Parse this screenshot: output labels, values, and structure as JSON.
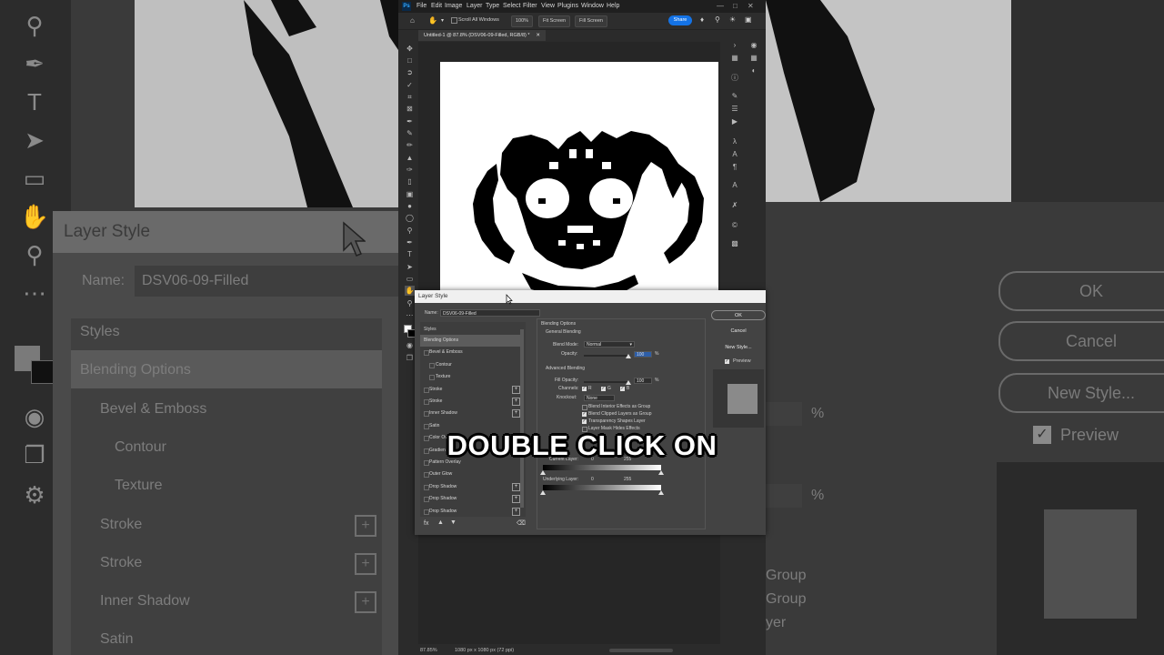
{
  "menu": {
    "app_badge": "Ps",
    "items": [
      "File",
      "Edit",
      "Image",
      "Layer",
      "Type",
      "Select",
      "Filter",
      "View",
      "Plugins",
      "Window",
      "Help"
    ]
  },
  "options_bar": {
    "scroll_all_windows": "Scroll All Windows",
    "zoom": "100%",
    "fit_screen": "Fit Screen",
    "fill_screen": "Fill Screen",
    "share": "Share"
  },
  "document_tab": "Untitled-1 @ 87.8% (DSV06-09-Filled, RGB/8) *",
  "status_bar": {
    "zoom": "87.85%",
    "size": "1080 px x 1080 px (72 ppi)"
  },
  "layer_style": {
    "title": "Layer Style",
    "name_label": "Name:",
    "name_value": "DSV06-09-Filled",
    "styles_header": "Styles",
    "items": [
      {
        "label": "Blending Options",
        "checkbox": false,
        "plus": false,
        "selected": true,
        "indent": false
      },
      {
        "label": "Bevel & Emboss",
        "checkbox": true,
        "plus": false,
        "selected": false,
        "indent": false
      },
      {
        "label": "Contour",
        "checkbox": true,
        "plus": false,
        "selected": false,
        "indent": true
      },
      {
        "label": "Texture",
        "checkbox": true,
        "plus": false,
        "selected": false,
        "indent": true
      },
      {
        "label": "Stroke",
        "checkbox": true,
        "plus": true,
        "selected": false,
        "indent": false
      },
      {
        "label": "Stroke",
        "checkbox": true,
        "plus": true,
        "selected": false,
        "indent": false
      },
      {
        "label": "Inner Shadow",
        "checkbox": true,
        "plus": true,
        "selected": false,
        "indent": false
      },
      {
        "label": "Satin",
        "checkbox": true,
        "plus": false,
        "selected": false,
        "indent": false
      },
      {
        "label": "Color Ov",
        "checkbox": true,
        "plus": false,
        "selected": false,
        "indent": false
      },
      {
        "label": "Gradien",
        "checkbox": true,
        "plus": false,
        "selected": false,
        "indent": false
      },
      {
        "label": "Pattern Overlay",
        "checkbox": true,
        "plus": false,
        "selected": false,
        "indent": false
      },
      {
        "label": "Outer Glow",
        "checkbox": true,
        "plus": false,
        "selected": false,
        "indent": false
      },
      {
        "label": "Drop Shadow",
        "checkbox": true,
        "plus": true,
        "selected": false,
        "indent": false
      },
      {
        "label": "Drop Shadow",
        "checkbox": true,
        "plus": true,
        "selected": false,
        "indent": false
      },
      {
        "label": "Drop Shadow",
        "checkbox": true,
        "plus": true,
        "selected": false,
        "indent": false
      }
    ],
    "blending": {
      "section_title": "Blending Options",
      "general_title": "General Blending",
      "blend_mode_label": "Blend Mode:",
      "blend_mode_value": "Normal",
      "opacity_label": "Opacity:",
      "opacity_value": "100",
      "percent": "%",
      "advanced_title": "Advanced Blending",
      "fill_opacity_label": "Fill Opacity:",
      "fill_opacity_value": "100",
      "channels_label": "Channels:",
      "channel_r": "R",
      "channel_g": "G",
      "channel_b": "B",
      "knockout_label": "Knockout:",
      "knockout_value": "None",
      "options": [
        {
          "label": "Blend Interior Effects as Group",
          "checked": false
        },
        {
          "label": "Blend Clipped Layers as Group",
          "checked": true
        },
        {
          "label": "Transparency Shapes Layer",
          "checked": true
        },
        {
          "label": "Layer Mask Hides Effects",
          "checked": false
        }
      ],
      "current_layer_label": "Current Layer:",
      "underlying_label": "Underlying Layer:",
      "range_min": "0",
      "range_max": "255"
    },
    "buttons": {
      "ok": "OK",
      "cancel": "Cancel",
      "new_style": "New Style...",
      "preview": "Preview"
    }
  },
  "background_zoom": {
    "title": "Layer Style",
    "name_label": "Name:",
    "name_value": "DSV06-09-Filled",
    "styles_header": "Styles",
    "items": [
      "Blending Options",
      "Bevel & Emboss",
      "Contour",
      "Texture",
      "Stroke",
      "Stroke",
      "Inner Shadow",
      "Satin"
    ],
    "buttons": [
      "OK",
      "Cancel",
      "New Style...",
      "Preview"
    ],
    "right_fragments": [
      "Group",
      "Group",
      "yer"
    ],
    "percent": "%"
  },
  "caption": "DOUBLE CLICK ON"
}
